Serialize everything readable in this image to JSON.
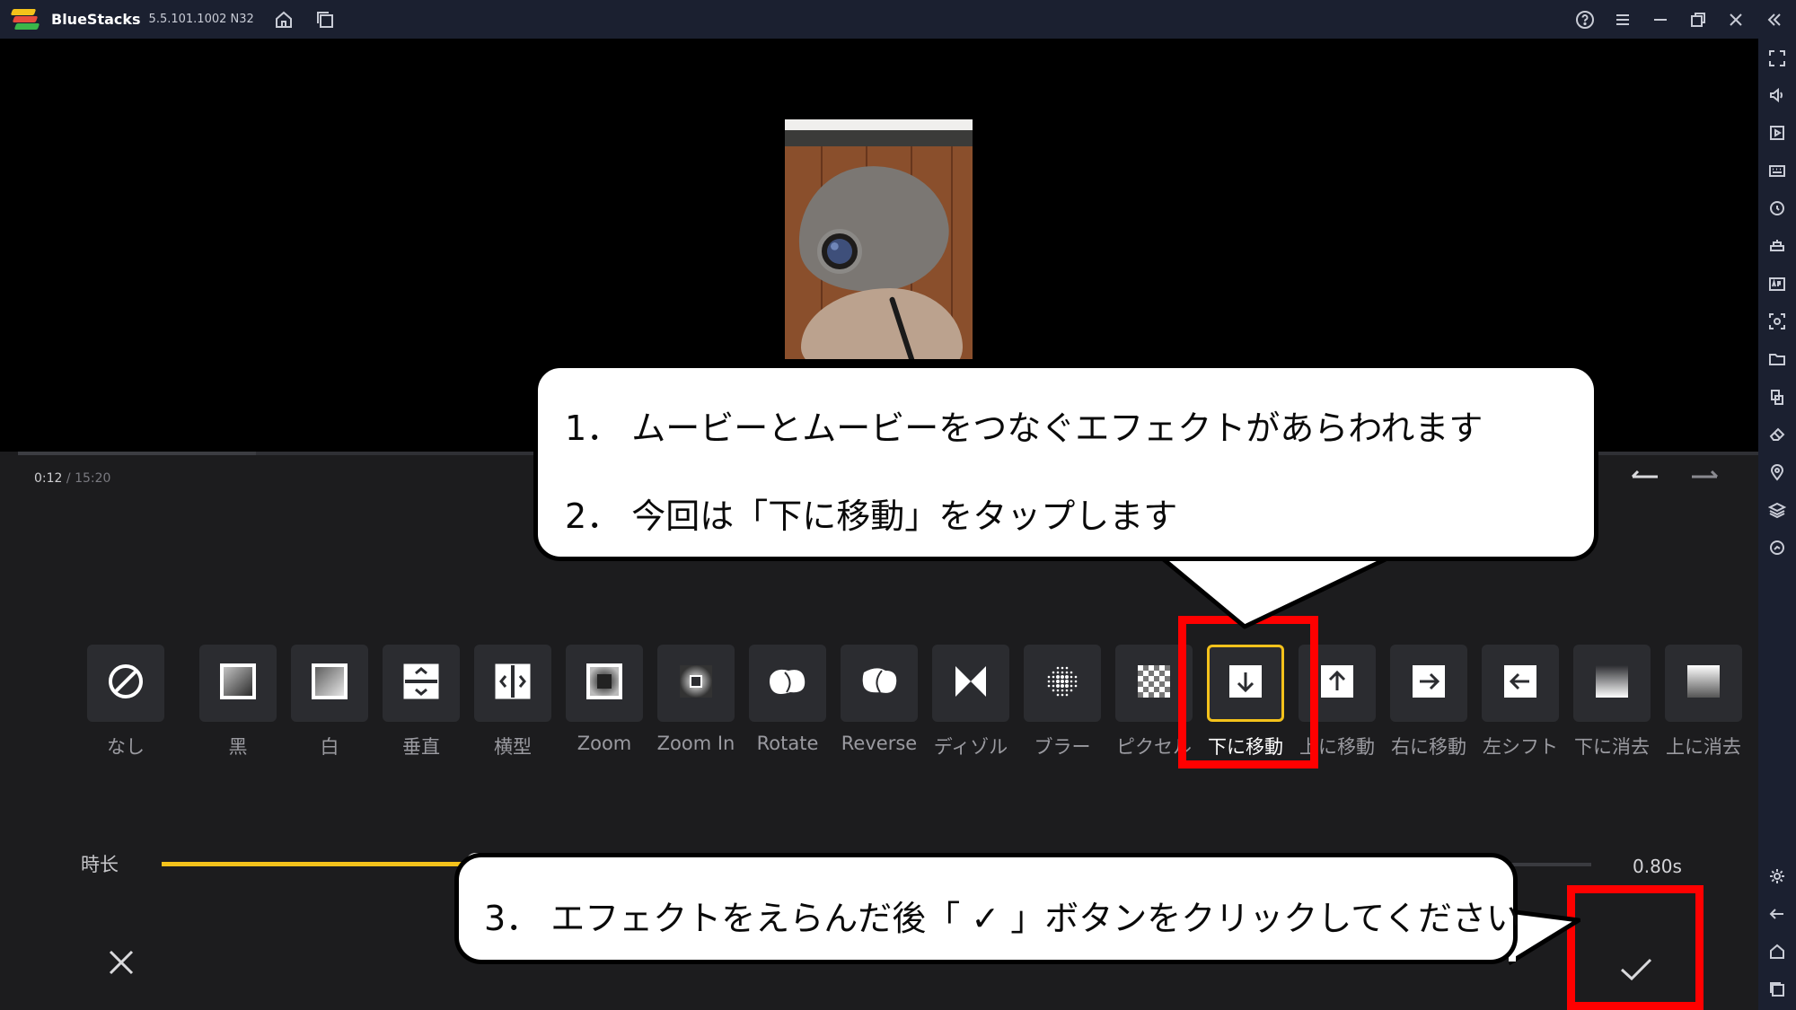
{
  "titlebar": {
    "app_name": "BlueStacks",
    "version": "5.5.101.1002  N32"
  },
  "player": {
    "time_current": "0:12",
    "time_total": " / 15:20"
  },
  "transitions": [
    {
      "label": "なし",
      "icon": "none-icon"
    },
    {
      "label": "黑",
      "icon": "fade-black-icon"
    },
    {
      "label": "白",
      "icon": "fade-white-icon"
    },
    {
      "label": "垂直",
      "icon": "vertical-split-icon"
    },
    {
      "label": "横型",
      "icon": "horizontal-split-icon"
    },
    {
      "label": "Zoom",
      "icon": "zoom-icon"
    },
    {
      "label": "Zoom In",
      "icon": "zoom-in-icon"
    },
    {
      "label": "Rotate",
      "icon": "rotate-icon"
    },
    {
      "label": "Reverse",
      "icon": "reverse-icon"
    },
    {
      "label": "ディゾル",
      "icon": "dissolve-icon"
    },
    {
      "label": "ブラー",
      "icon": "blur-icon"
    },
    {
      "label": "ピクセル",
      "icon": "pixel-icon"
    },
    {
      "label": "下に移動",
      "icon": "arrow-down-icon",
      "selected": true
    },
    {
      "label": "上に移動",
      "icon": "arrow-up-icon"
    },
    {
      "label": "右に移動",
      "icon": "arrow-right-icon"
    },
    {
      "label": "左シフト",
      "icon": "arrow-left-icon"
    },
    {
      "label": "下に消去",
      "icon": "wipe-down-icon"
    },
    {
      "label": "上に消去",
      "icon": "wipe-up-icon"
    }
  ],
  "duration": {
    "label": "時长",
    "value": "0.80s",
    "fill_fraction": 0.22
  },
  "callouts": {
    "step1": "1．  ムービーとムービーをつなぐエフェクトがあらわれます",
    "step2": "2．  今回は「下に移動」をタップします",
    "step3": "3．  エフェクトをえらんだ後「 ✓ 」ボタンをクリックしてください"
  },
  "colors": {
    "accent": "#f4c21b",
    "annotation_red": "#ff0000",
    "panel_bg": "#1c1c1e",
    "chrome_bg": "#1b2030"
  }
}
